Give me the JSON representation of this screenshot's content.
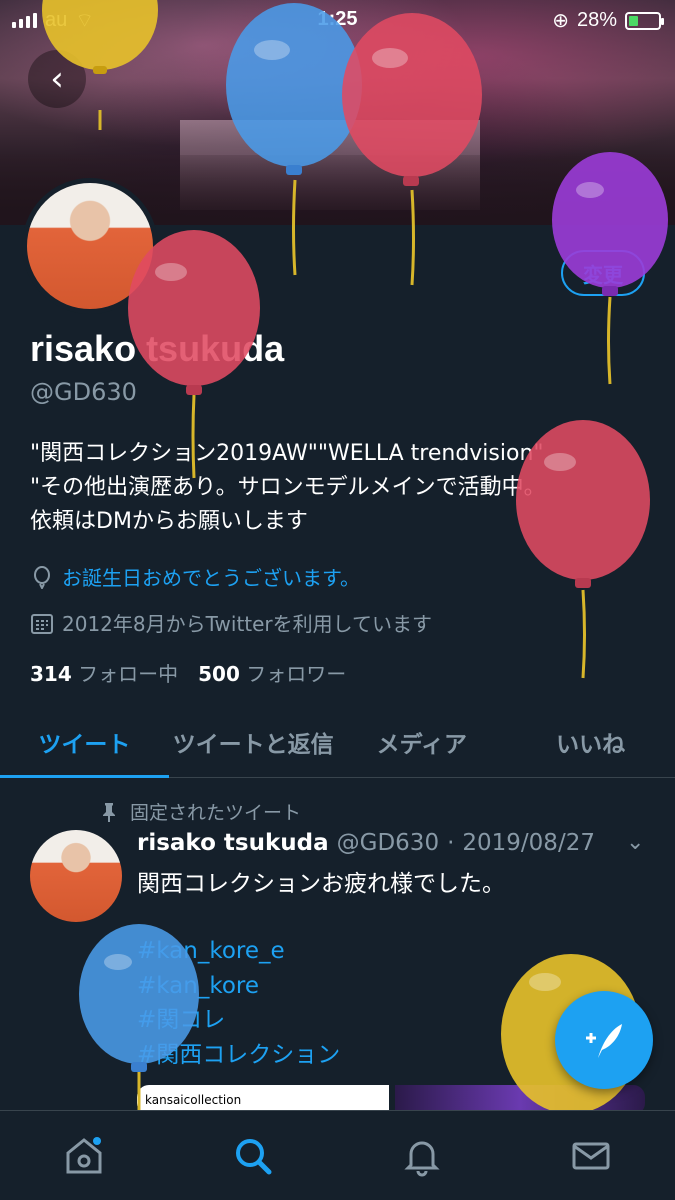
{
  "status_bar": {
    "carrier": "au",
    "time": "1:25",
    "battery": "28%"
  },
  "profile": {
    "name": "risako tsukuda",
    "handle": "@GD630",
    "edit_label": "変更",
    "bio_line1": "\"関西コレクション2019AW\"\"WELLA trendvision\"",
    "bio_line2": "\"その他出演歴あり。サロンモデルメインで活動中。",
    "bio_line3": "依頼はDMからお願いします",
    "birthday_text": "お誕生日おめでとうございます。",
    "joined_text": "2012年8月からTwitterを利用しています",
    "following_count": "314",
    "following_label": "フォロー中",
    "followers_count": "500",
    "followers_label": "フォロワー"
  },
  "tabs": [
    {
      "label": "ツイート",
      "active": true
    },
    {
      "label": "ツイートと返信",
      "active": false
    },
    {
      "label": "メディア",
      "active": false
    },
    {
      "label": "いいね",
      "active": false
    }
  ],
  "pinned_tweet": {
    "pinned_label": "固定されたツイート",
    "author_name": "risako tsukuda",
    "author_handle": "@GD630",
    "date": "2019/08/27",
    "text": "関西コレクションお疲れ様でした。",
    "hashtags": [
      "#kan_kore_e",
      "#kan_kore",
      "#関コレ",
      "#関西コレクション"
    ],
    "media_account": "kansaicollection"
  },
  "colors": {
    "background": "#15202b",
    "accent": "#1da1f2",
    "muted": "#8899a6"
  },
  "icons": {
    "back": "back-arrow-icon",
    "balloon": "balloon-icon",
    "calendar": "calendar-icon",
    "pin": "pin-icon",
    "chevron": "chevron-down-icon",
    "compose": "compose-icon",
    "home": "home-icon",
    "search": "search-icon",
    "bell": "bell-icon",
    "mail": "mail-icon"
  }
}
